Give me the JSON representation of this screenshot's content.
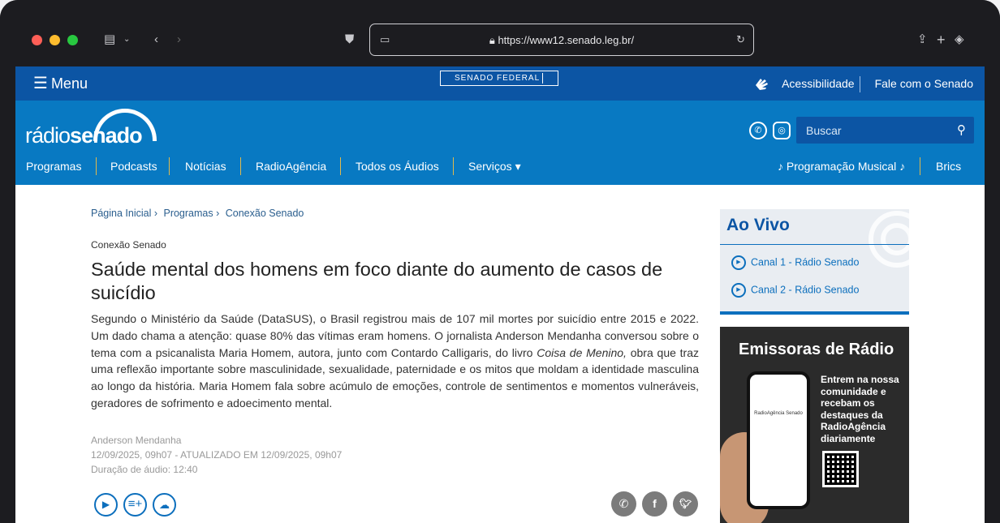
{
  "browser": {
    "url": "https://www12.senado.leg.br/"
  },
  "topbar": {
    "menu_label": "Menu",
    "logo_text": "SENADO FEDERAL",
    "accessibility": "Acessibilidade",
    "contact": "Fale com o Senado"
  },
  "header": {
    "logo_part1": "rádio",
    "logo_part2": "senado",
    "search_placeholder": "Buscar",
    "nav": [
      "Programas",
      "Podcasts",
      "Notícias",
      "RadioAgência",
      "Todos os Áudios",
      "Serviços ▾"
    ],
    "nav_right": [
      "♪ Programação Musical ♪",
      "Brics"
    ]
  },
  "breadcrumb": [
    "Página Inicial ›",
    "Programas ›",
    "Conexão Senado"
  ],
  "article": {
    "kicker": "Conexão Senado",
    "title": "Saúde mental dos homens em foco diante do aumento de casos de suicídio",
    "body_part1": "Segundo o Ministério da Saúde (DataSUS), o Brasil registrou mais de 107 mil mortes por suicídio entre 2015 e 2022. Um dado chama a atenção: quase 80% das vítimas eram homens. O jornalista Anderson Mendanha conversou sobre o tema com a psicanalista Maria Homem, autora, junto com Contardo Calligaris, do livro ",
    "body_italic": "Coisa de Menino,",
    "body_part2": " obra que traz uma reflexão importante sobre masculinidade, sexualidade, paternidade e os mitos que moldam a identidade masculina ao longo da história. Maria Homem fala sobre acúmulo de emoções, controle de sentimentos e momentos vulneráveis, geradores de sofrimento e adoecimento mental.",
    "author": "Anderson Mendanha",
    "dates": "12/09/2025, 09h07 - ATUALIZADO EM 12/09/2025, 09h07",
    "duration": "Duração de áudio: 12:40"
  },
  "sidebar": {
    "live_title": "Ao Vivo",
    "channels": [
      "Canal 1 - Rádio Senado",
      "Canal 2 - Rádio Senado"
    ],
    "banner_title": "Emissoras de Rádio",
    "banner_text": "Entrem na nossa comunidade e recebam os destaques da RadioAgência diariamente",
    "phone_text": "RadioAgência Senado"
  },
  "colors": {
    "topbar": "#0c55a4",
    "header": "#0879c2",
    "accent": "#0c6fbd"
  }
}
